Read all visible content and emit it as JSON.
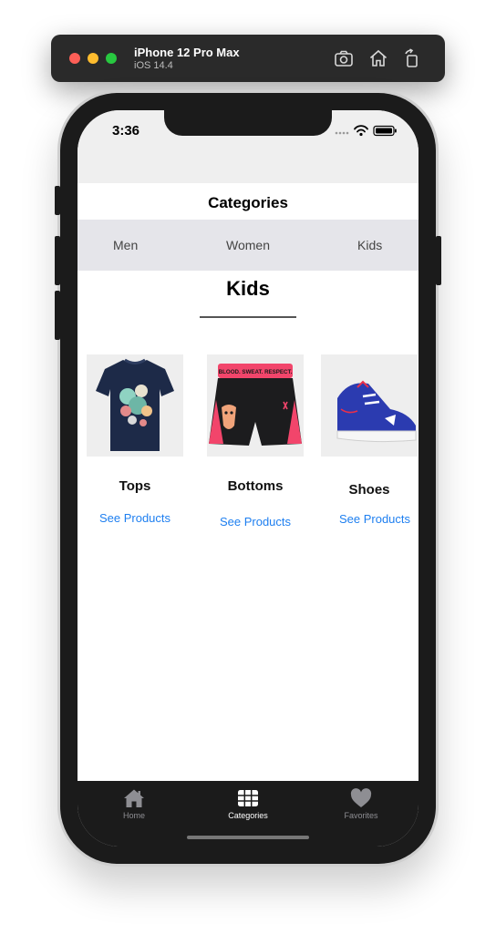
{
  "simulator": {
    "device_name": "iPhone 12 Pro Max",
    "os_version": "iOS 14.4",
    "icons": [
      "screenshot-icon",
      "home-icon",
      "rotate-icon"
    ]
  },
  "status_bar": {
    "time": "3:36",
    "icons": [
      "signal-dots-icon",
      "wifi-icon",
      "battery-icon"
    ]
  },
  "nav": {
    "title": "Categories"
  },
  "segments": {
    "items": [
      {
        "label": "Men"
      },
      {
        "label": "Women"
      },
      {
        "label": "Kids"
      }
    ],
    "selected": "Kids"
  },
  "section": {
    "title": "Kids"
  },
  "categories": [
    {
      "name": "Tops",
      "link": "See Products",
      "image": "navy-graphic-tshirt"
    },
    {
      "name": "Bottoms",
      "link": "See Products",
      "image": "black-pink-shorts",
      "waistband_text": "BLOOD. SWEAT. RESPECT."
    },
    {
      "name": "Shoes",
      "link": "See Products",
      "image": "blue-white-sneaker"
    }
  ],
  "tabbar": {
    "items": [
      {
        "label": "Home",
        "icon": "house-icon"
      },
      {
        "label": "Categories",
        "icon": "grid-icon"
      },
      {
        "label": "Favorites",
        "icon": "heart-icon"
      }
    ],
    "selected": "Categories",
    "colors": {
      "active": "#ffffff",
      "inactive": "#8e8e93"
    }
  },
  "colors": {
    "link": "#1e7ff0",
    "segment_background": "#e5e5ea",
    "status_background": "#efefef"
  }
}
